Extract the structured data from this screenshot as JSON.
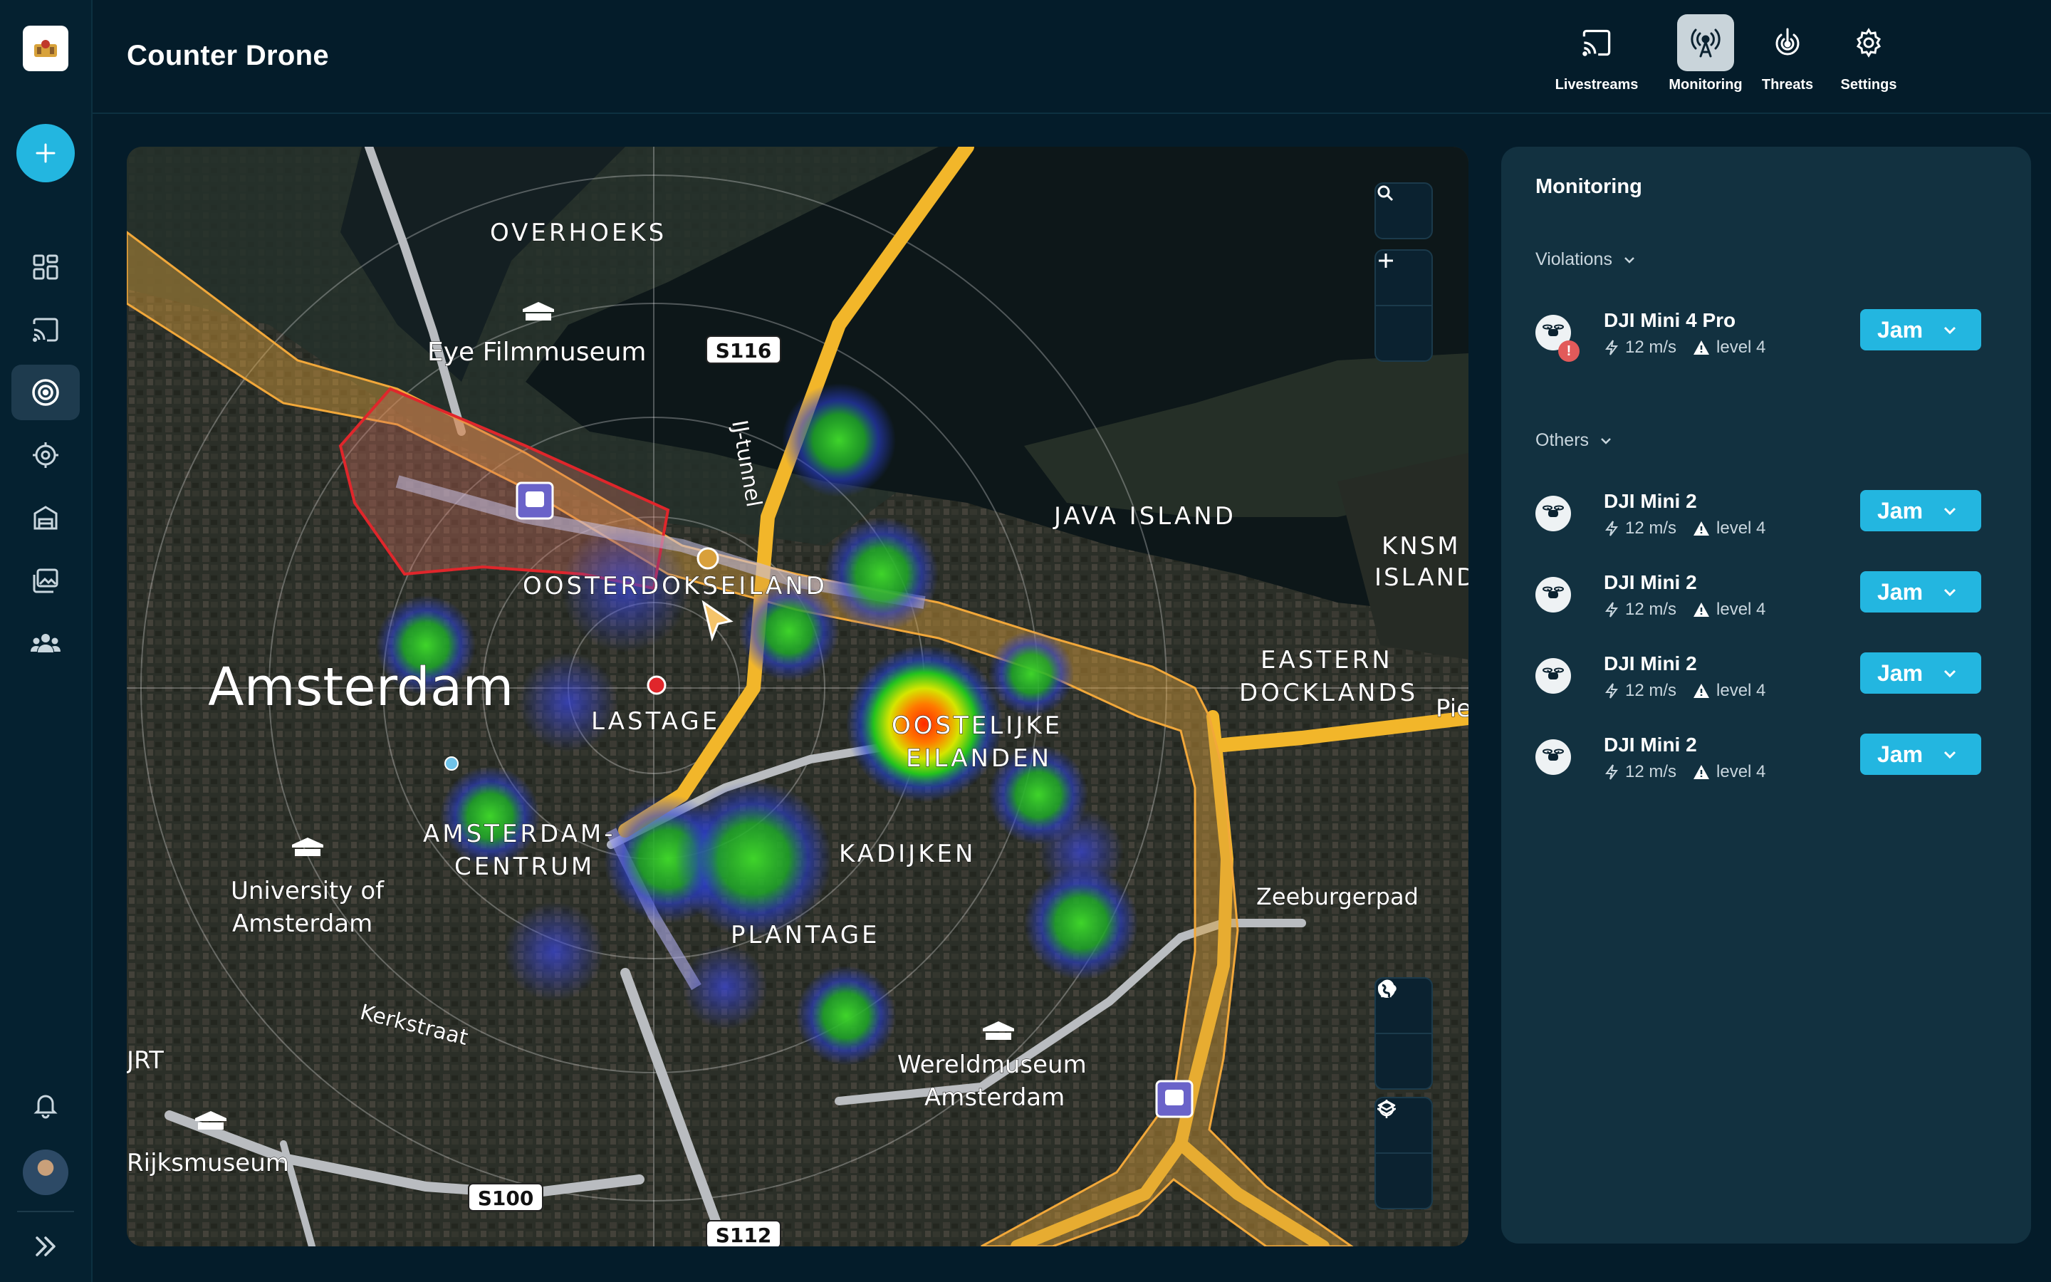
{
  "app": {
    "title": "Counter Drone"
  },
  "top_nav": [
    {
      "label": "Livestreams",
      "icon": "cast-icon",
      "active": false
    },
    {
      "label": "Monitoring",
      "icon": "broadcast-tower-icon",
      "active": true
    },
    {
      "label": "Threats",
      "icon": "target-hand-icon",
      "active": false
    },
    {
      "label": "Settings",
      "icon": "gear-icon",
      "active": false
    }
  ],
  "sidebar": {
    "items": [
      {
        "icon": "dashboard-grid-icon",
        "active": false
      },
      {
        "icon": "cast-icon",
        "active": false
      },
      {
        "icon": "radar-icon",
        "active": true
      },
      {
        "icon": "crosshair-icon",
        "active": false
      },
      {
        "icon": "building-icon",
        "active": false
      },
      {
        "icon": "gallery-icon",
        "active": false
      },
      {
        "icon": "team-icon",
        "active": false
      }
    ],
    "bottom": [
      "bell-icon",
      "avatar",
      "expand-chevrons-icon"
    ]
  },
  "map": {
    "labels": {
      "overhoeks": "OVERHOEKS",
      "eye": "Eye Filmmuseum",
      "s116": "S116",
      "ij_tunnel": "IJ-tunnel",
      "java": "JAVA ISLAND",
      "knsm1": "KNSM",
      "knsm2": "ISLAND",
      "oosterdok": "OOSTERDOKSEILAND",
      "eastern1": "EASTERN",
      "eastern2": "DOCKLANDS",
      "pie": "Pie",
      "amsterdam": "Amsterdam",
      "lastage": "LASTAGE",
      "oostelijke1": "OOSTELIJKE",
      "oostelijke2": "EILANDEN",
      "centrum1": "AMSTERDAM-",
      "centrum2": "CENTRUM",
      "kadijken": "KADIJKEN",
      "uva1": "University of",
      "uva2": "Amsterdam",
      "zeeburgerpad": "Zeeburgerpad",
      "plantage": "PLANTAGE",
      "kerkstraat": "Kerkstraat",
      "jrt": "JRT",
      "wereld1": "Wereldmuseum",
      "wereld2": "Amsterdam",
      "rijks": "Rijksmuseum",
      "s100": "S100",
      "s112": "S112"
    },
    "controls": [
      "search-icon",
      "zoom-in-icon",
      "zoom-out-icon",
      "weather-icon",
      "globe-icon",
      "layers-icon",
      "locate-icon"
    ]
  },
  "monitoring": {
    "title": "Monitoring",
    "violations_label": "Violations",
    "others_label": "Others",
    "violations": [
      {
        "name": "DJI Mini 4 Pro",
        "speed": "12 m/s",
        "level": "level 4",
        "action": "Jam",
        "alert": "!"
      }
    ],
    "others": [
      {
        "name": "DJI Mini 2",
        "speed": "12 m/s",
        "level": "level 4",
        "action": "Jam"
      },
      {
        "name": "DJI Mini 2",
        "speed": "12 m/s",
        "level": "level 4",
        "action": "Jam"
      },
      {
        "name": "DJI Mini 2",
        "speed": "12 m/s",
        "level": "level 4",
        "action": "Jam"
      },
      {
        "name": "DJI Mini 2",
        "speed": "12 m/s",
        "level": "level 4",
        "action": "Jam"
      }
    ]
  },
  "colors": {
    "accent": "#23b6e0",
    "background": "#041c2a",
    "panel": "#123140",
    "route": "#f2b62a",
    "zone_red": "#e0262b"
  }
}
